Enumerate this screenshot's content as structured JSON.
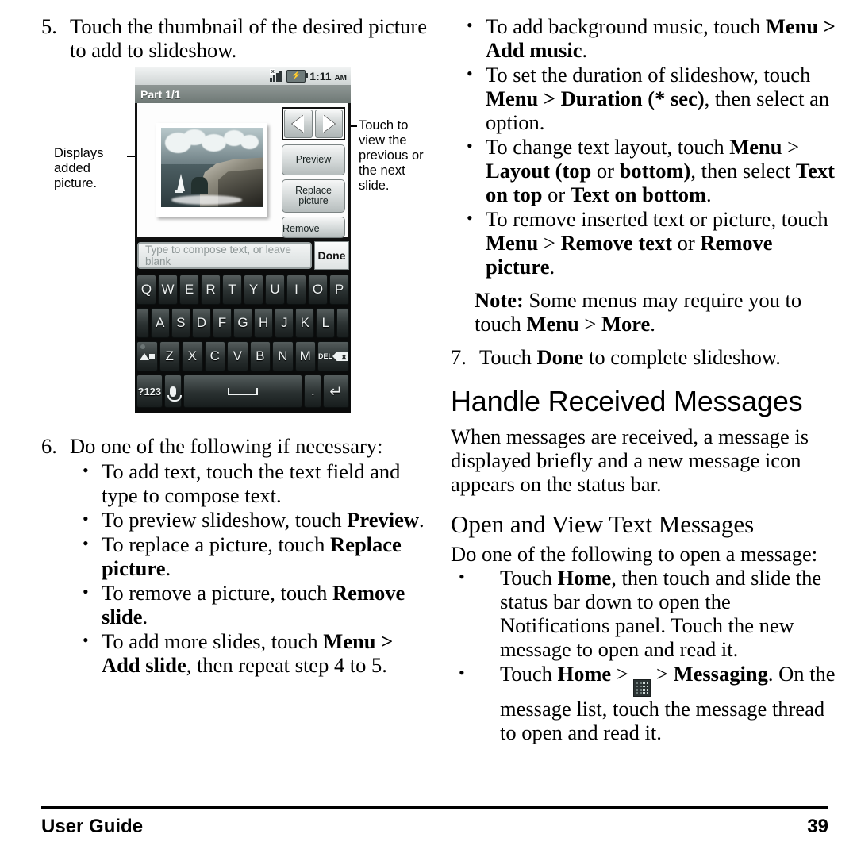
{
  "footer": {
    "left_label": "User Guide",
    "page_number": "39"
  },
  "left_column": {
    "step5": {
      "number": "5.",
      "text": "Touch the thumbnail of the desired picture to add to slideshow."
    },
    "figure": {
      "callout_left": "Displays added picture.",
      "callout_right": "Touch to view the previous or the next slide.",
      "status_bar": {
        "time": "1:11",
        "meridiem": "AM",
        "signal_icon": "signal-bars-icon",
        "battery_icon": "battery-charging-icon"
      },
      "title_bar": "Part 1/1",
      "nav_prev_icon": "triangle-left-icon",
      "nav_next_icon": "triangle-right-icon",
      "buttons": [
        "Preview",
        "Replace picture",
        "Remove"
      ],
      "compose_placeholder": "Type to compose text, or leave blank",
      "done_label": "Done",
      "keyboard": {
        "row1": [
          "Q",
          "W",
          "E",
          "R",
          "T",
          "Y",
          "U",
          "I",
          "O",
          "P"
        ],
        "row2": [
          "A",
          "S",
          "D",
          "F",
          "G",
          "H",
          "J",
          "K",
          "L"
        ],
        "row3": [
          "Z",
          "X",
          "C",
          "V",
          "B",
          "N",
          "M"
        ],
        "shift_icon": "shift-arrow-icon",
        "delete_label": "DEL",
        "delete_icon": "backspace-icon",
        "symbols_label": "?123",
        "mic_icon": "microphone-icon",
        "space_icon": "spacebar-icon",
        "period_label": ".",
        "enter_icon": "enter-return-icon"
      }
    },
    "step6": {
      "number": "6.",
      "text": "Do one of the following if necessary:",
      "bullets": [
        {
          "parts": [
            {
              "t": "To add text, touch the text field and type to compose text.",
              "b": false
            }
          ]
        },
        {
          "parts": [
            {
              "t": "To preview slideshow, touch ",
              "b": false
            },
            {
              "t": "Preview",
              "b": true
            },
            {
              "t": ".",
              "b": false
            }
          ]
        },
        {
          "parts": [
            {
              "t": "To replace a picture, touch ",
              "b": false
            },
            {
              "t": "Replace picture",
              "b": true
            },
            {
              "t": ".",
              "b": false
            }
          ]
        },
        {
          "parts": [
            {
              "t": "To remove a picture, touch ",
              "b": false
            },
            {
              "t": "Remove slide",
              "b": true
            },
            {
              "t": ".",
              "b": false
            }
          ]
        },
        {
          "parts": [
            {
              "t": "To add more slides, touch ",
              "b": false
            },
            {
              "t": "Menu > Add slide",
              "b": true
            },
            {
              "t": ", then repeat step 4 to 5.",
              "b": false
            }
          ]
        }
      ]
    }
  },
  "right_column": {
    "top_bullets": [
      {
        "parts": [
          {
            "t": "To add background music, touch ",
            "b": false
          },
          {
            "t": "Menu > Add music",
            "b": true
          },
          {
            "t": ".",
            "b": false
          }
        ]
      },
      {
        "parts": [
          {
            "t": "To set the duration of slideshow, touch ",
            "b": false
          },
          {
            "t": "Menu > Duration (* sec)",
            "b": true
          },
          {
            "t": ", then select an option.",
            "b": false
          }
        ]
      },
      {
        "parts": [
          {
            "t": "To change text layout, touch ",
            "b": false
          },
          {
            "t": "Menu",
            "b": true
          },
          {
            "t": " > ",
            "b": false
          },
          {
            "t": "Layout (top",
            "b": true
          },
          {
            "t": " or ",
            "b": false
          },
          {
            "t": "bottom)",
            "b": true
          },
          {
            "t": ", then select ",
            "b": false
          },
          {
            "t": "Text on top",
            "b": true
          },
          {
            "t": " or ",
            "b": false
          },
          {
            "t": "Text on bottom",
            "b": true
          },
          {
            "t": ".",
            "b": false
          }
        ]
      },
      {
        "parts": [
          {
            "t": "To remove inserted text or picture, touch ",
            "b": false
          },
          {
            "t": "Menu",
            "b": true
          },
          {
            "t": " > ",
            "b": false
          },
          {
            "t": "Remove text",
            "b": true
          },
          {
            "t": " or ",
            "b": false
          },
          {
            "t": "Remove picture",
            "b": true
          },
          {
            "t": ".",
            "b": false
          }
        ]
      }
    ],
    "note": {
      "parts": [
        {
          "t": "Note:",
          "b": true
        },
        {
          "t": " Some menus may require you to touch ",
          "b": false
        },
        {
          "t": "Menu",
          "b": true
        },
        {
          "t": " > ",
          "b": false
        },
        {
          "t": "More",
          "b": true
        },
        {
          "t": ".",
          "b": false
        }
      ]
    },
    "step7": {
      "number": "7.",
      "parts": [
        {
          "t": "Touch ",
          "b": false
        },
        {
          "t": "Done",
          "b": true
        },
        {
          "t": " to complete slideshow.",
          "b": false
        }
      ]
    },
    "heading_main": "Handle Received Messages",
    "intro_paragraph": "When messages are received, a message is displayed briefly and a new message icon appears on the status bar.",
    "heading_sub": "Open and View Text Messages",
    "sub_intro": "Do one of the following to open a message:",
    "sub_bullets": [
      {
        "parts": [
          {
            "t": "Touch ",
            "b": false
          },
          {
            "t": "Home",
            "b": true
          },
          {
            "t": ", then touch and slide the status bar down to open the Notifications panel. Touch the new message to open and read it.",
            "b": false
          }
        ]
      },
      {
        "icon_after": "launcher-grid-icon",
        "parts_before": [
          {
            "t": "Touch ",
            "b": false
          },
          {
            "t": "Home",
            "b": true
          },
          {
            "t": " > ",
            "b": false
          }
        ],
        "parts_after": [
          {
            "t": " > ",
            "b": false
          },
          {
            "t": "Messaging",
            "b": true
          },
          {
            "t": ". On the message list, touch the message thread to open and read it.",
            "b": false
          }
        ]
      }
    ]
  }
}
